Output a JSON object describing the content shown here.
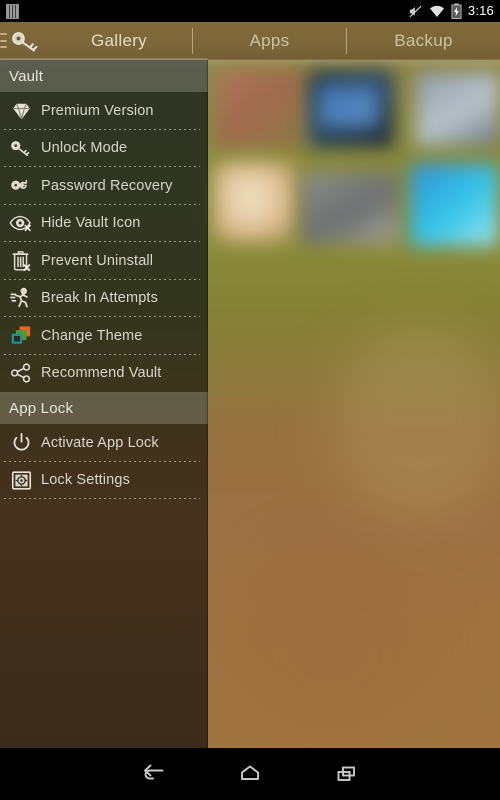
{
  "status_bar": {
    "left_icon": "sim-card-icon",
    "icons": [
      "silent-mode-icon",
      "wifi-icon",
      "battery-charging-icon"
    ],
    "time": "3:16"
  },
  "tab_bar": {
    "menu_icon": "hamburger-menu-icon",
    "app_icon": "key-icon",
    "tabs": [
      {
        "label": "Gallery",
        "active": true
      },
      {
        "label": "Apps",
        "active": false
      },
      {
        "label": "Backup",
        "active": false
      }
    ]
  },
  "drawer": {
    "sections": [
      {
        "title": "Vault",
        "items": [
          {
            "label": "Premium Version",
            "icon": "diamond-icon"
          },
          {
            "label": "Unlock Mode",
            "icon": "key-icon"
          },
          {
            "label": "Password Recovery",
            "icon": "key-recovery-icon"
          },
          {
            "label": "Hide Vault Icon",
            "icon": "eye-hidden-icon"
          },
          {
            "label": "Prevent Uninstall",
            "icon": "trash-blocked-icon"
          },
          {
            "label": "Break In Attempts",
            "icon": "running-intruder-icon"
          },
          {
            "label": "Change Theme",
            "icon": "layered-squares-icon"
          },
          {
            "label": "Recommend Vault",
            "icon": "share-icon"
          }
        ]
      },
      {
        "title": "App Lock",
        "items": [
          {
            "label": "Activate App Lock",
            "icon": "power-icon"
          },
          {
            "label": "Lock Settings",
            "icon": "safe-lock-icon"
          }
        ]
      }
    ]
  },
  "nav_bar": {
    "buttons": [
      {
        "name": "back",
        "icon": "back-arrow-icon"
      },
      {
        "name": "home",
        "icon": "home-icon"
      },
      {
        "name": "recents",
        "icon": "recent-apps-icon"
      }
    ]
  },
  "colors": {
    "accent_brown": "#806838",
    "drawer_overlay": "#1e2220",
    "section_header": "#bebcb0",
    "text_primary": "#d8d6cc",
    "theme_orange": "#e8661f",
    "theme_green": "#4c9b3a",
    "theme_teal": "#1f8f93"
  }
}
